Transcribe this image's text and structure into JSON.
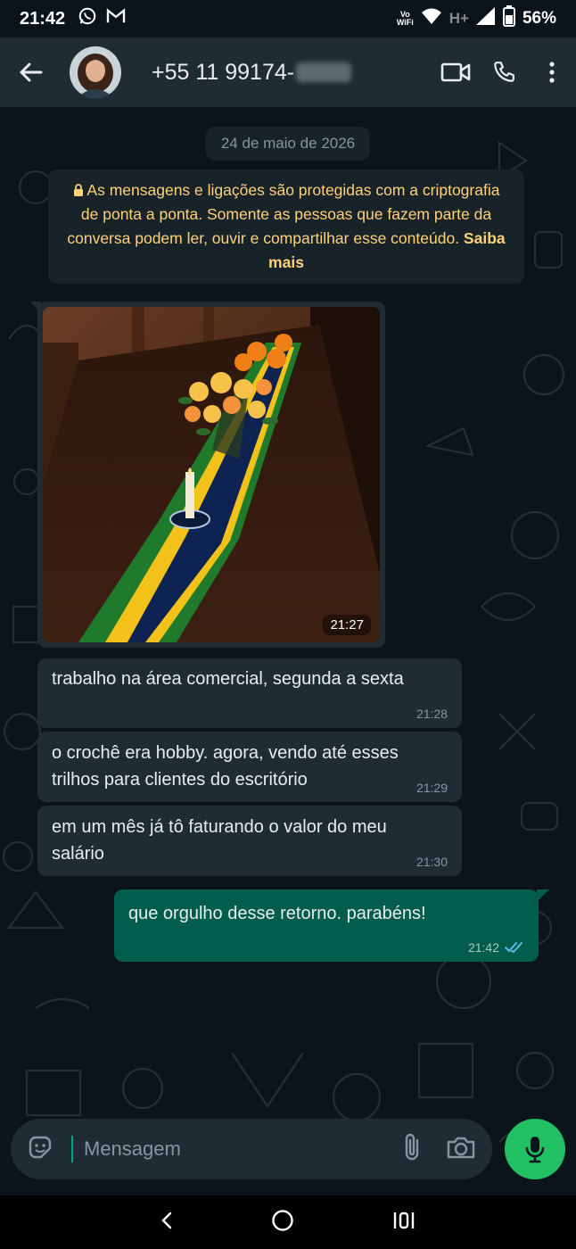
{
  "status_bar": {
    "time": "21:42",
    "volte_line1": "Vo",
    "volte_line2": "WiFi",
    "network": "H+",
    "battery": "56%"
  },
  "header": {
    "contact_name": "+55 11 99174-"
  },
  "chat": {
    "date_chip": "24 de maio de 2026",
    "encryption_notice": "As mensagens e ligações são protegidas com a criptografia de ponta a ponta. Somente as pessoas que fazem parte da conversa podem ler, ouvir e compartilhar esse conteúdo.",
    "encryption_link": "Saiba mais",
    "messages": [
      {
        "type": "image",
        "time": "21:27"
      },
      {
        "text": "trabalho na área comercial, segunda a sexta",
        "time": "21:28"
      },
      {
        "text": "o crochê era hobby. agora, vendo até esses trilhos para clientes do escritório",
        "time": "21:29"
      },
      {
        "text": "em um mês já tô faturando o valor do meu salário",
        "time": "21:30"
      },
      {
        "text": "que orgulho desse retorno. parabéns!",
        "time": "21:42",
        "status": "read"
      }
    ]
  },
  "composer": {
    "placeholder": "Mensagem"
  },
  "colors": {
    "accent": "#00a884",
    "mic_button": "#21c063",
    "outgoing_bubble": "#005c4b",
    "incoming_bubble": "#1f2c34",
    "read_ticks": "#53bdeb"
  }
}
